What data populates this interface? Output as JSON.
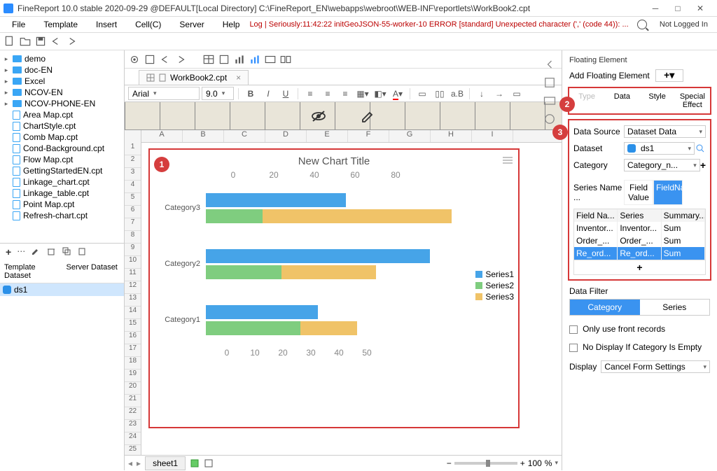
{
  "title": "FineReport 10.0 stable 2020-09-29 @DEFAULT[Local Directory]   C:\\FineReport_EN\\webapps\\webroot\\WEB-INF\\reportlets\\WorkBook2.cpt",
  "menu": {
    "file": "File",
    "template": "Template",
    "insert": "Insert",
    "cell": "Cell(C)",
    "server": "Server",
    "help": "Help"
  },
  "log_msg": "Log | Seriously:11:42:22 initGeoJSON-55-worker-10 ERROR [standard] Unexpected character (',' (code 44)): ...",
  "not_logged": "Not Logged In",
  "tree": {
    "folders": [
      "demo",
      "doc-EN",
      "Excel",
      "NCOV-EN",
      "NCOV-PHONE-EN"
    ],
    "files": [
      "Area Map.cpt",
      "ChartStyle.cpt",
      "Comb Map.cpt",
      "Cond-Background.cpt",
      "Flow Map.cpt",
      "GettingStartedEN.cpt",
      "Linkage_chart.cpt",
      "Linkage_table.cpt",
      "Point Map.cpt",
      "Refresh-chart.cpt"
    ]
  },
  "ds_headers": {
    "tpl": "Template Dataset",
    "srv": "Server Dataset"
  },
  "ds_name": "ds1",
  "tab_name": "WorkBook2.cpt",
  "font_name": "Arial",
  "font_size": "9.0",
  "cols": [
    "A",
    "B",
    "C",
    "D",
    "E",
    "F",
    "G",
    "H",
    "I"
  ],
  "chart_title": "New Chart Title",
  "axis_top": [
    "0",
    "20",
    "40",
    "60",
    "80"
  ],
  "axis_bot": [
    "0",
    "10",
    "20",
    "30",
    "40",
    "50"
  ],
  "cats": [
    "Category3",
    "Category2",
    "Category1"
  ],
  "legend": [
    "Series1",
    "Series2",
    "Series3"
  ],
  "sheet": "sheet1",
  "zoom": "100",
  "zoom_pct": "%",
  "rp": {
    "title": "Floating Element",
    "add": "Add Floating Element",
    "tabs": {
      "type": "Type",
      "data": "Data",
      "style": "Style",
      "effect": "Special Effect"
    },
    "data_source_lbl": "Data Source",
    "data_source_val": "Dataset Data",
    "dataset_lbl": "Dataset",
    "dataset_val": "ds1",
    "category_lbl": "Category",
    "category_val": "Category_n...",
    "series_name_lbl": "Series Name ...",
    "series_opt_field": "Field Value",
    "series_opt_name": "FieldName",
    "tbl_hdr": {
      "f": "Field Na...",
      "s": "Series",
      "m": "Summary..."
    },
    "tbl_rows": [
      {
        "f": "Inventor...",
        "s": "Inventor...",
        "m": "Sum"
      },
      {
        "f": "Order_...",
        "s": "Order_...",
        "m": "Sum"
      },
      {
        "f": "Re_ord...",
        "s": "Re_ord...",
        "m": "Sum"
      }
    ],
    "filter_title": "Data Filter",
    "filter_cat": "Category",
    "filter_ser": "Series",
    "chk_front": "Only use front records",
    "chk_nodisp": "No Display If Category Is Empty",
    "display_lbl": "Display",
    "display_val": "Cancel Form Settings"
  },
  "chart_data": {
    "type": "bar",
    "orientation": "horizontal",
    "title": "New Chart Title",
    "categories": [
      "Category3",
      "Category2",
      "Category1"
    ],
    "series": [
      {
        "name": "Series1",
        "values": [
          50,
          80,
          40
        ],
        "color": "#46a4e8",
        "axis": "top"
      },
      {
        "name": "Series2",
        "values": [
          15,
          20,
          25
        ],
        "color": "#7fcd7f",
        "axis": "bottom",
        "stack": "s"
      },
      {
        "name": "Series3",
        "values": [
          50,
          25,
          15
        ],
        "color": "#f0c368",
        "axis": "bottom",
        "stack": "s"
      }
    ],
    "xlim_top": [
      0,
      80
    ],
    "xlim_bottom": [
      0,
      50
    ]
  },
  "badges": {
    "b1": "1",
    "b2": "2",
    "b3": "3"
  }
}
